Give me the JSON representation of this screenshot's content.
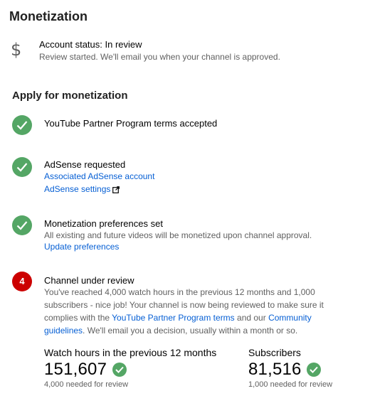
{
  "page": {
    "title": "Monetization"
  },
  "account_status": {
    "icon": "dollar-icon",
    "title": "Account status: In review",
    "description": "Review started. We'll email you when your channel is approved."
  },
  "apply": {
    "title": "Apply for monetization",
    "steps": [
      {
        "status": "complete",
        "icon": "check-circle-icon",
        "title": "YouTube Partner Program terms accepted"
      },
      {
        "status": "complete",
        "icon": "check-circle-icon",
        "title": "AdSense requested",
        "links": [
          "Associated AdSense account",
          "AdSense settings"
        ]
      },
      {
        "status": "complete",
        "icon": "check-circle-icon",
        "title": "Monetization preferences set",
        "description": "All existing and future videos will be monetized upon channel approval.",
        "link": "Update preferences"
      },
      {
        "status": "current",
        "number": "4",
        "title": "Channel under review",
        "text_part1": "You've reached 4,000 watch hours in the previous 12 months and 1,000 subscribers - nice job! Your channel is now being reviewed to make sure it complies with the ",
        "link1": "YouTube Partner Program terms",
        "text_part2": " and our ",
        "link2": "Community guidelines",
        "text_part3": ". We'll email you a decision, usually within a month or so."
      }
    ]
  },
  "stats": {
    "watch_hours": {
      "label": "Watch hours in the previous 12 months",
      "value": "151,607",
      "note": "4,000 needed for review"
    },
    "subscribers": {
      "label": "Subscribers",
      "value": "81,516",
      "note": "1,000 needed for review"
    }
  },
  "colors": {
    "check_green": "#54a665",
    "step_red": "#cc0000",
    "link_blue": "#065fd4"
  }
}
